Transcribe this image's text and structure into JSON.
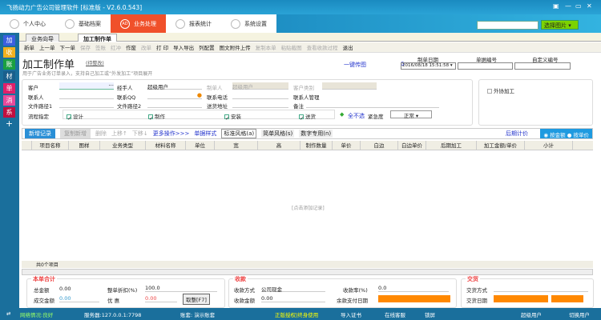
{
  "window": {
    "title": "飞扬动力广告公司管理软件 [标准版 - V2.6.0.543]"
  },
  "nav": [
    {
      "label": "个人中心",
      "icon": "user-icon"
    },
    {
      "label": "基础档案",
      "icon": "archive-icon"
    },
    {
      "label": "业务处理",
      "icon": "ad-icon",
      "badge": "AD",
      "active": true
    },
    {
      "label": "报表统计",
      "icon": "chart-icon"
    },
    {
      "label": "系统设置",
      "icon": "gear-icon"
    }
  ],
  "top_search": {
    "value": "",
    "button": "选择图片"
  },
  "sidebar": [
    "加",
    "收",
    "账",
    "材",
    "单",
    "消",
    "系",
    "+"
  ],
  "sidebar_colors": [
    "#3a5fe0",
    "#f0b020",
    "#1aa040",
    "#1a5f8c",
    "#e0206a",
    "#e84a9a",
    "#c01040",
    "#1a6f9c"
  ],
  "tabs": [
    "业务向导",
    "加工制作单"
  ],
  "toolbar": [
    {
      "label": "新单",
      "enabled": true
    },
    {
      "label": "上一单",
      "enabled": true
    },
    {
      "label": "下一单",
      "enabled": true
    },
    {
      "label": "保存",
      "enabled": false
    },
    {
      "label": "签账",
      "enabled": false
    },
    {
      "label": "红冲",
      "enabled": false
    },
    {
      "label": "作废",
      "enabled": true
    },
    {
      "label": "改单",
      "enabled": false
    },
    {
      "label": "打 印",
      "enabled": true
    },
    {
      "label": "导入导出",
      "enabled": true
    },
    {
      "label": "列配置",
      "enabled": true
    },
    {
      "label": "图文附件上传",
      "enabled": true
    },
    {
      "label": "复制本单",
      "enabled": false
    },
    {
      "label": "粘贴截图",
      "enabled": false
    },
    {
      "label": "查看收款过程",
      "enabled": false
    },
    {
      "label": "退出",
      "enabled": true
    }
  ],
  "page": {
    "title": "加工制作单",
    "note": "(待整改)",
    "subtitle": "用于广告业务订单录入，支持自己加工或“外发加工”项目展开",
    "upload_link": "一键传图",
    "attach_count": "0"
  },
  "header_fields": {
    "date_label": "制单日期",
    "date_value": "2016/08/18 15:51:58",
    "bill_no_label": "单据编号",
    "bill_no": "",
    "custom_no_label": "自定义编号",
    "custom_no": ""
  },
  "form": {
    "customer": {
      "label": "客户",
      "value": ""
    },
    "handler": {
      "label": "经手人",
      "value": "超级用户"
    },
    "maker": {
      "label": "制单人",
      "value": "超级用户"
    },
    "customer_type": {
      "label": "客户类别",
      "value": ""
    },
    "contact": {
      "label": "联系人",
      "value": ""
    },
    "qq": {
      "label": "联系QQ",
      "value": ""
    },
    "phone": {
      "label": "联系电话",
      "value": ""
    },
    "contact_mgr": "联系人管理",
    "path1": {
      "label": "文件路径1",
      "value": ""
    },
    "path2": {
      "label": "文件路径2",
      "value": ""
    },
    "address": {
      "label": "送货地址",
      "value": ""
    },
    "remark": {
      "label": "备注",
      "value": ""
    },
    "flow_label": "流程指定",
    "flow": [
      {
        "label": "设计",
        "checked": true
      },
      {
        "label": "制作",
        "checked": true
      },
      {
        "label": "安装",
        "checked": true
      },
      {
        "label": "送货",
        "checked": true
      }
    ],
    "none_link": "全不选",
    "urgency_label": "紧急度",
    "urgency": "正常",
    "outsource": {
      "label": "外协加工",
      "checked": false
    }
  },
  "gridbar": {
    "add": "新增记录",
    "copy": "复制新增",
    "delete": "删除",
    "up": "上移↑",
    "down": "下移↓",
    "more": "更多操作>>>",
    "style": "单据样式",
    "styles": [
      "标准风格(a)",
      "简单风格(s)",
      "数字专用(n)"
    ],
    "later_price": "后期计价",
    "mode_amount": "按金额",
    "mode_unit": "按单价"
  },
  "table": {
    "columns": [
      "项目名称",
      "图样",
      "业务类型",
      "材料名称",
      "单位",
      "宽",
      "高",
      "制作数量",
      "单价",
      "白边",
      "白边单价",
      "后期加工",
      "加工金额/单价",
      "小计"
    ],
    "rows": [],
    "empty": "[点击添加记录]",
    "footer": "共0个项目"
  },
  "totals": {
    "title": "本单合计",
    "total_label": "总金额",
    "total": "0.00",
    "discount_label": "整单折扣(%)",
    "discount": "100.0",
    "deal_label": "成交金额",
    "deal": "0.00",
    "favor_label": "优 惠",
    "favor": "0.00",
    "round_btn": "取整[F7]"
  },
  "payment": {
    "title": "收款",
    "method_label": "收款方式",
    "method": "公司现金",
    "rate_label": "收款率(%)",
    "rate": "0.0",
    "amount_label": "收款金额",
    "amount": "0.00",
    "due_label": "余款支付日期",
    "due": ""
  },
  "delivery": {
    "title": "交货",
    "method_label": "交货方式",
    "method": "",
    "date_label": "交货日期",
    "date": ""
  },
  "status": {
    "network": "网络情况:良好",
    "server": "服务器:127.0.0.1:7798",
    "account": "账套: 演示账套",
    "license": "正版授权|终身使用",
    "import_cert": "导入证书",
    "support": "在线客服",
    "lock": "锁屏",
    "user": "超级用户",
    "switch": "切换用户"
  }
}
